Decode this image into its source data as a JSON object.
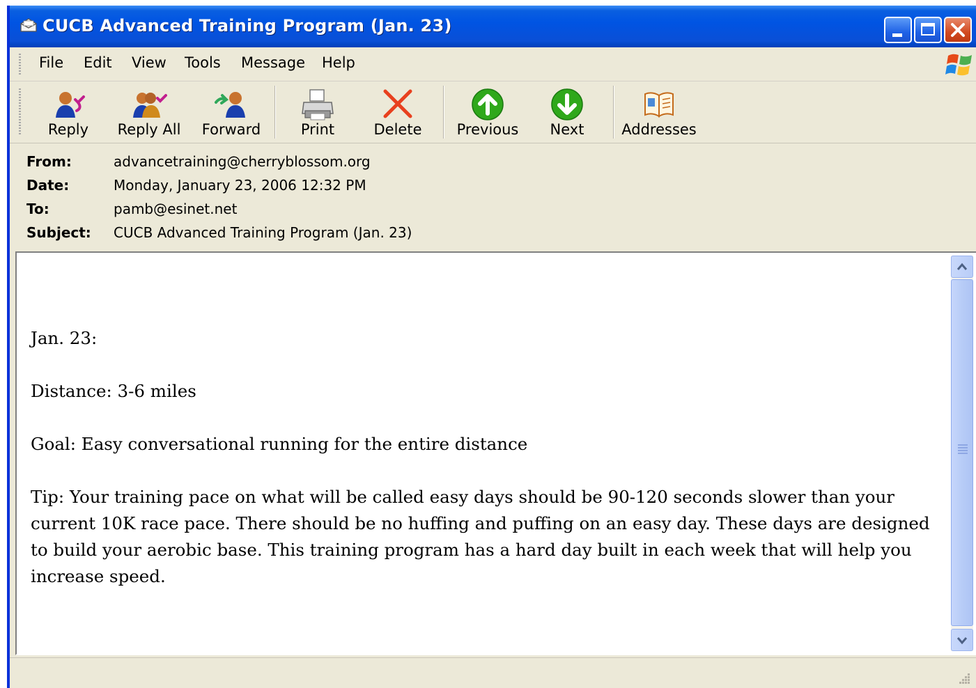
{
  "window": {
    "title": "CUCB Advanced Training Program (Jan. 23)"
  },
  "menu": [
    "File",
    "Edit",
    "View",
    "Tools",
    "Message",
    "Help"
  ],
  "toolbar": {
    "reply": "Reply",
    "reply_all": "Reply All",
    "forward": "Forward",
    "print": "Print",
    "delete": "Delete",
    "previous": "Previous",
    "next": "Next",
    "addresses": "Addresses"
  },
  "headers": {
    "from_label": "From:",
    "from": "advancetraining@cherryblossom.org",
    "date_label": "Date:",
    "date": "Monday, January 23, 2006 12:32 PM",
    "to_label": "To:",
    "to": "pamb@esinet.net",
    "subject_label": "Subject:",
    "subject": "CUCB Advanced Training Program (Jan. 23)"
  },
  "message": {
    "date_line": "Jan. 23:",
    "distance": "Distance: 3-6 miles",
    "goal": "Goal: Easy conversational running for the entire distance",
    "tip": "Tip: Your training pace on what will be called easy days should be 90-120 seconds slower than your current 10K race pace. There should be no huffing and puffing on an easy day. These days are designed to build your aerobic base. This training program has a hard day built in each week that will help you increase speed."
  },
  "icons": {
    "title": "envelope-icon",
    "reply": "reply-icon",
    "reply_all": "reply-all-icon",
    "forward": "forward-icon",
    "print": "printer-icon",
    "delete": "delete-x-icon",
    "previous": "arrow-up-icon",
    "next": "arrow-down-icon",
    "addresses": "address-book-icon"
  },
  "colors": {
    "titlebar": "#0054e3",
    "chrome": "#ece9d8",
    "delete": "#e8401e",
    "nav_green": "#2fa81b",
    "scroll": "#b9cdf8"
  }
}
